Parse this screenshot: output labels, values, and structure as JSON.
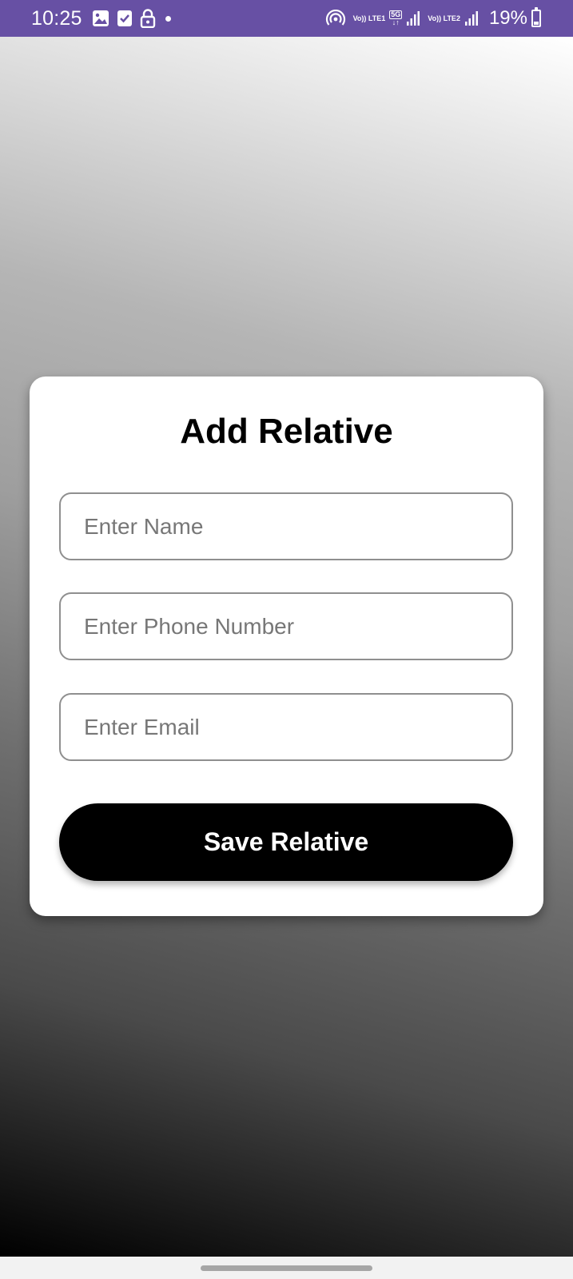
{
  "status_bar": {
    "time": "10:25",
    "net1": "Vo)) LTE1",
    "net_5g": "5G",
    "net2": "Vo)) LTE2",
    "battery": "19%",
    "icons": [
      "image-icon",
      "check-box-icon",
      "lock-icon",
      "dot-icon",
      "hotspot-icon",
      "signal-icon",
      "signal-icon",
      "battery-icon"
    ]
  },
  "form": {
    "title": "Add Relative",
    "name_placeholder": "Enter Name",
    "phone_placeholder": "Enter Phone Number",
    "email_placeholder": "Enter Email",
    "name_value": "",
    "phone_value": "",
    "email_value": "",
    "save_label": "Save Relative"
  },
  "colors": {
    "status_bar": "#6750a4",
    "button": "#000000",
    "card": "#ffffff"
  }
}
